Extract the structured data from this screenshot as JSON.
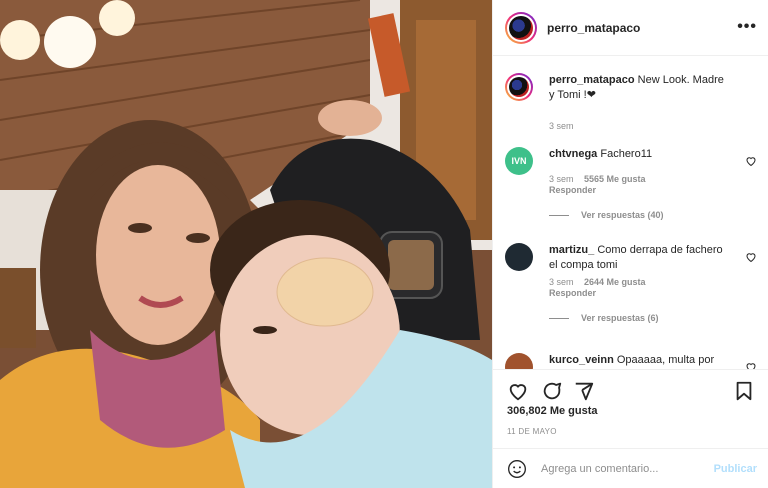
{
  "post": {
    "username": "perro_matapaco",
    "likes_label": "306,802 Me gusta",
    "date": "11 DE MAYO"
  },
  "caption": {
    "username": "perro_matapaco",
    "text": "New Look. Madre y Tomi !❤",
    "time": "3 sem"
  },
  "comments": [
    {
      "username": "chtvnega",
      "text": "Fachero11",
      "time": "3 sem",
      "likes": "5565 Me gusta",
      "reply": "Responder",
      "view_replies": "Ver respuestas (40)",
      "avatar_color": "#3ec08a"
    },
    {
      "username": "martizu_",
      "text": "Como derrapa de fachero el compa tomi",
      "time": "3 sem",
      "likes": "2644 Me gusta",
      "reply": "Responder",
      "view_replies": "Ver respuestas (6)",
      "avatar_color": "#1f2a33"
    },
    {
      "username": "kurco_veinn",
      "text": "Opaaaaa, multa por",
      "avatar_color": "#a0522d"
    }
  ],
  "comment_box": {
    "placeholder": "Agrega un comentario...",
    "publish_label": "Publicar"
  },
  "icons": {
    "more": "more-options-icon",
    "heart": "heart-icon",
    "comment": "comment-icon",
    "share": "share-icon",
    "save": "bookmark-icon",
    "emoji": "emoji-icon"
  },
  "colors": {
    "accent_disabled": "#b2dffc",
    "meta_gray": "#8e8e8e"
  }
}
